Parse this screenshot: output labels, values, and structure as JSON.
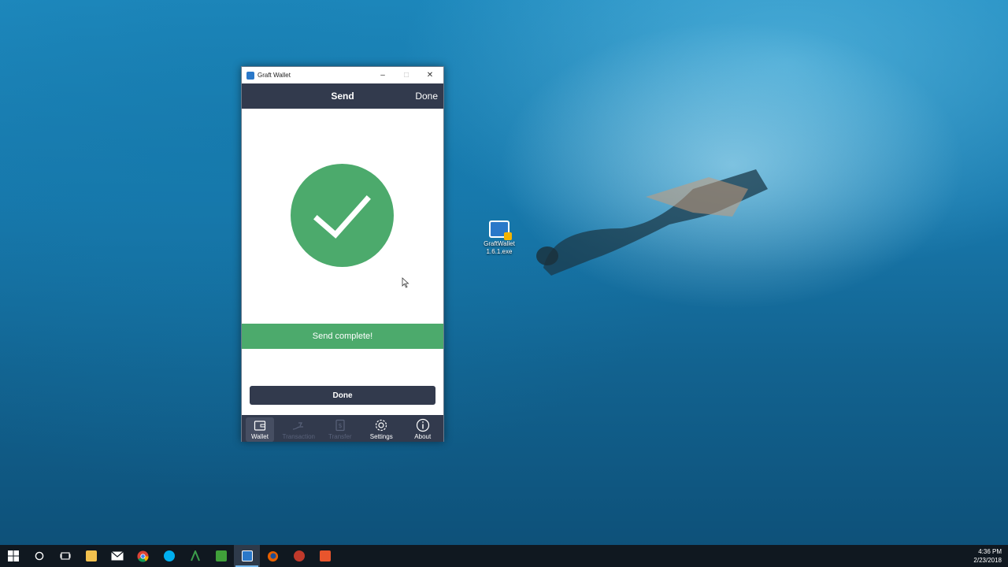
{
  "window": {
    "title": "Graft Wallet"
  },
  "header": {
    "title": "Send",
    "done_label": "Done"
  },
  "status": {
    "message": "Send complete!"
  },
  "actions": {
    "done_button_label": "Done"
  },
  "bottom_nav": {
    "items": [
      {
        "label": "Wallet",
        "icon": "wallet-icon",
        "state": "active"
      },
      {
        "label": "Transaction",
        "icon": "transaction-icon",
        "state": "disabled"
      },
      {
        "label": "Transfer",
        "icon": "transfer-icon",
        "state": "disabled"
      },
      {
        "label": "Settings",
        "icon": "gear-icon",
        "state": "enabled"
      },
      {
        "label": "About",
        "icon": "info-icon",
        "state": "enabled"
      }
    ]
  },
  "desktop": {
    "icon_label_line1": "GraftWallet",
    "icon_label_line2": "1.6.1.exe"
  },
  "taskbar": {
    "time": "4:36 PM",
    "date": "2/23/2018",
    "apps": [
      "windows-start-icon",
      "cortana-icon",
      "task-view-icon",
      "file-explorer-icon",
      "mail-icon",
      "chrome-icon",
      "skype-icon",
      "app-icon",
      "camtasia-icon",
      "graft-wallet-icon",
      "firefox-icon",
      "app-red-icon",
      "app-orange-icon"
    ]
  },
  "colors": {
    "header_bg": "#323a4d",
    "success_green": "#4caa6c",
    "desktop_blue": "#1879ad"
  }
}
